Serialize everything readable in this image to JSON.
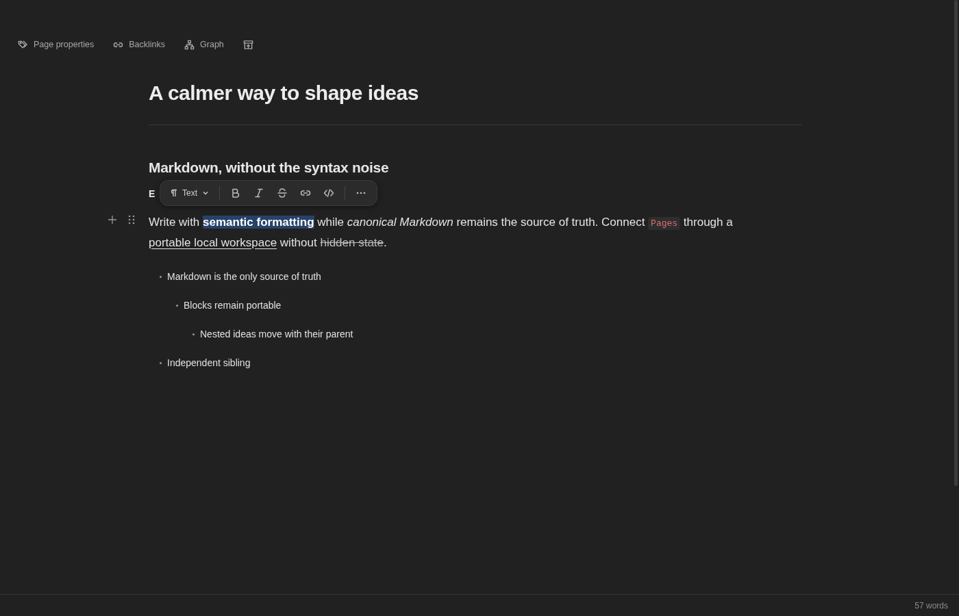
{
  "toolbar": [
    {
      "kind": "tag",
      "label": "Page properties"
    },
    {
      "kind": "link",
      "label": "Backlinks"
    },
    {
      "kind": "graph",
      "label": "Graph"
    },
    {
      "kind": "archive"
    }
  ],
  "title": "A calmer way to shape ideas",
  "heading": "Markdown, without the syntax noise",
  "hidden_block": "E",
  "format_bar": {
    "block_type": "Text",
    "buttons": [
      {
        "kind": "bold"
      },
      {
        "kind": "italic"
      },
      {
        "kind": "strike"
      },
      {
        "kind": "link"
      },
      {
        "kind": "code"
      },
      {
        "kind": "more"
      }
    ]
  },
  "paragraph": [
    {
      "kind": "text",
      "text": "Write with "
    },
    {
      "kind": "bold",
      "text": "semantic formatting",
      "selected": true
    },
    {
      "kind": "text",
      "text": " while "
    },
    {
      "kind": "italic",
      "text": "canonical Markdown"
    },
    {
      "kind": "text",
      "text": " remains the source of truth. Connect "
    },
    {
      "kind": "code",
      "text": "Pages"
    },
    {
      "kind": "text",
      "text": " through a "
    },
    {
      "kind": "link",
      "text": "portable local workspace"
    },
    {
      "kind": "text",
      "text": " without "
    },
    {
      "kind": "strike",
      "text": "hidden state"
    },
    {
      "kind": "text",
      "text": "."
    }
  ],
  "bullets": [
    {
      "text": "Markdown is the only source of truth",
      "children": [
        {
          "text": "Blocks remain portable",
          "children": [
            {
              "text": "Nested ideas move with their parent"
            }
          ]
        }
      ]
    },
    {
      "text": "Independent sibling"
    }
  ],
  "status_bar": {
    "word_count": "57 words"
  }
}
